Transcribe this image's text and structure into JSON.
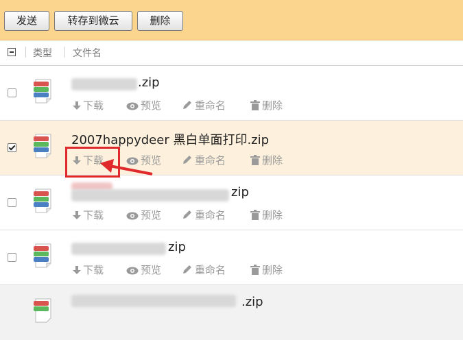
{
  "toolbar": {
    "send_label": "发送",
    "save_cloud_label": "转存到微云",
    "delete_label": "删除"
  },
  "header": {
    "col_type": "类型",
    "col_filename": "文件名"
  },
  "rows": [
    {
      "name": ".zip",
      "checked": false
    },
    {
      "name": "2007happydeer 黑白单面打印.zip",
      "checked": true
    },
    {
      "name": "zip",
      "checked": false
    },
    {
      "name": "zip",
      "checked": false
    },
    {
      "name": ".zip",
      "checked": false
    }
  ],
  "actions": {
    "download": "下载",
    "preview": "预览",
    "rename": "重命名",
    "delete": "删除"
  },
  "colors": {
    "toolbar_bg": "#fbd58e",
    "selected_row_bg": "#fdf1dd",
    "annotation_red": "#e0292b"
  }
}
